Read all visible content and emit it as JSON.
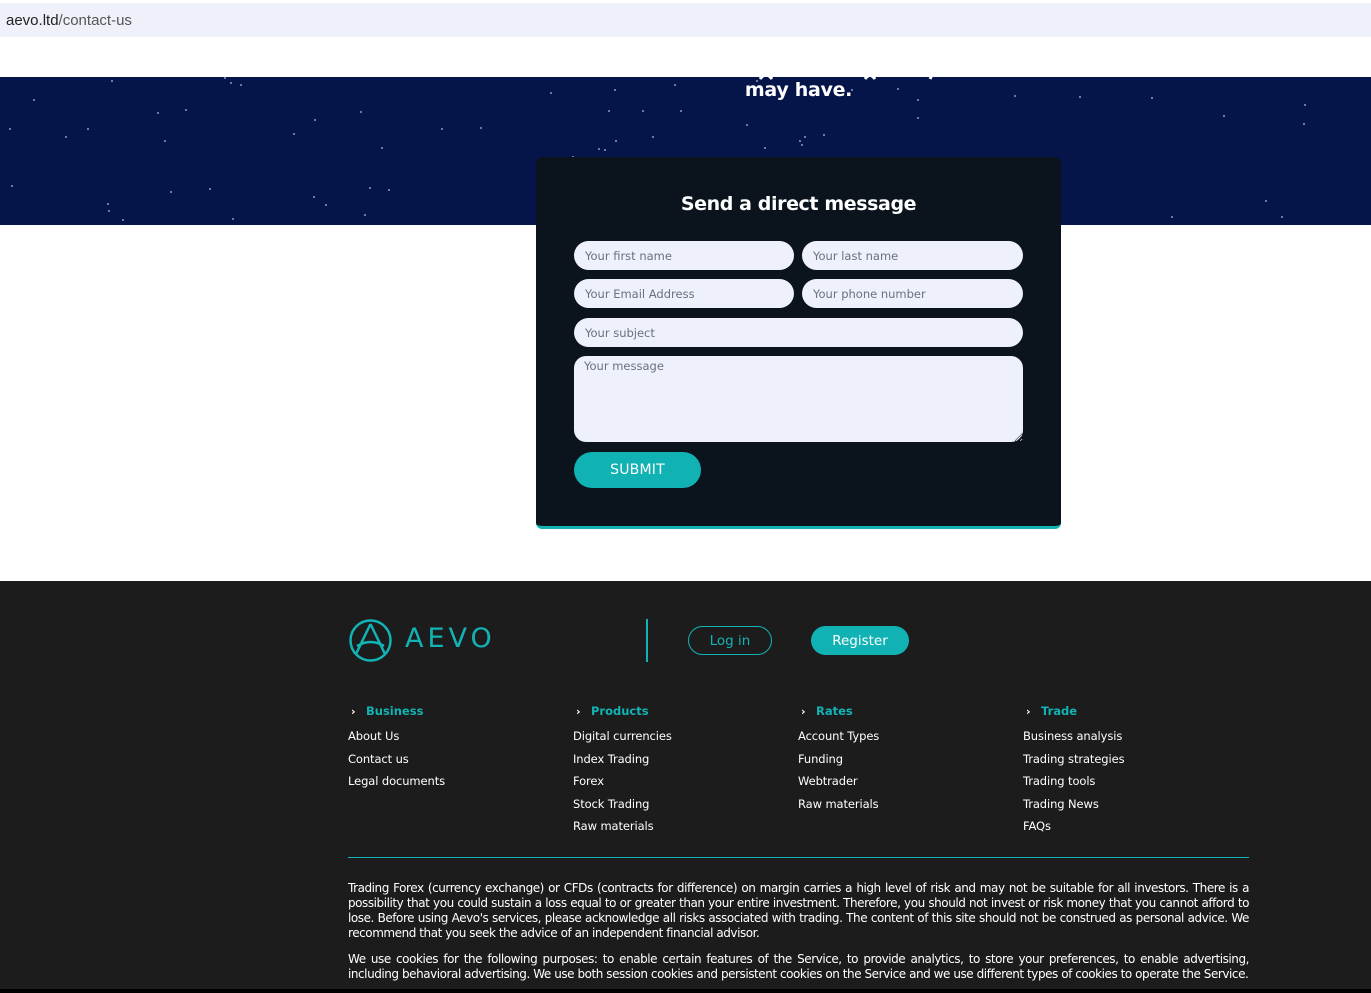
{
  "browser": {
    "url_domain": "aevo.ltd",
    "url_path": "/contact-us"
  },
  "hero": {
    "partial_text": "may have."
  },
  "form": {
    "title": "Send a direct message",
    "first_name_placeholder": "Your first name",
    "last_name_placeholder": "Your last name",
    "email_placeholder": "Your Email Address",
    "phone_placeholder": "Your phone number",
    "subject_placeholder": "Your subject",
    "message_placeholder": "Your message",
    "submit_label": "SUBMIT"
  },
  "footer": {
    "logo_text": "AEVO",
    "login_label": "Log in",
    "register_label": "Register",
    "columns": [
      {
        "title": "Business",
        "links": [
          "About Us",
          "Contact us",
          "Legal documents"
        ]
      },
      {
        "title": "Products",
        "links": [
          "Digital currencies",
          "Index Trading",
          "Forex",
          "Stock Trading",
          "Raw materials"
        ]
      },
      {
        "title": "Rates",
        "links": [
          "Account Types",
          "Funding",
          "Webtrader",
          "Raw materials"
        ]
      },
      {
        "title": "Trade",
        "links": [
          "Business analysis",
          "Trading strategies",
          "Trading tools",
          "Trading News",
          "FAQs"
        ]
      }
    ],
    "disclaimer_1": "Trading Forex (currency exchange) or CFDs (contracts for difference) on margin carries a high level of risk and may not be suitable for all investors. There is a possibility that you could sustain a loss equal to or greater than your entire investment. Therefore, you should not invest or risk money that you cannot afford to lose. Before using Aevo's services, please acknowledge all risks associated with trading. The content of this site should not be construed as personal advice. We recommend that you seek the advice of an independent financial advisor.",
    "disclaimer_2": "We use cookies for the following purposes: to enable certain features of the Service, to provide analytics, to store your preferences, to enable advertising, including behavioral advertising. We use both session cookies and persistent cookies on the Service and we use different types of cookies to operate the Service."
  },
  "colors": {
    "accent": "#12b3b5",
    "hero_bg": "#051449",
    "card_bg": "#0b141d",
    "footer_bg": "#1c1c1c"
  }
}
